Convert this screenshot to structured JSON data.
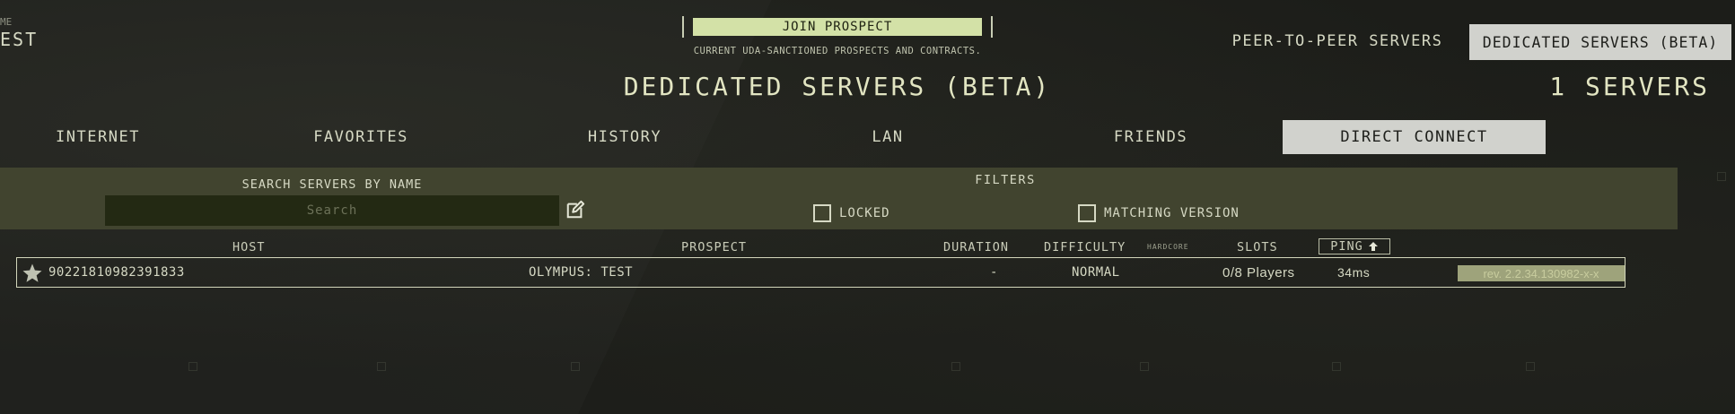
{
  "profile": {
    "label": "ME",
    "name": "EST"
  },
  "join": {
    "button_label": "JOIN PROSPECT",
    "subtitle": "CURRENT UDA-SANCTIONED PROSPECTS AND CONTRACTS."
  },
  "server_type_tabs": [
    {
      "label": "PEER-TO-PEER SERVERS",
      "active": false
    },
    {
      "label": "DEDICATED SERVERS (BETA)",
      "active": true
    }
  ],
  "title": "DEDICATED SERVERS (BETA)",
  "server_count": "1 SERVERS",
  "category_tabs": [
    {
      "label": "INTERNET",
      "active": false
    },
    {
      "label": "FAVORITES",
      "active": false
    },
    {
      "label": "HISTORY",
      "active": false
    },
    {
      "label": "LAN",
      "active": false
    },
    {
      "label": "FRIENDS",
      "active": false
    },
    {
      "label": "DIRECT CONNECT",
      "active": true
    }
  ],
  "search": {
    "label": "SEARCH SERVERS BY NAME",
    "placeholder": "Search",
    "value": ""
  },
  "filters": {
    "label": "FILTERS",
    "options": [
      {
        "label": "LOCKED",
        "checked": false
      },
      {
        "label": "MATCHING VERSION",
        "checked": false
      }
    ]
  },
  "columns": {
    "host": "HOST",
    "prospect": "PROSPECT",
    "duration": "DURATION",
    "difficulty": "DIFFICULTY",
    "hardcore": "HARDCORE",
    "slots": "SLOTS",
    "ping": "PING"
  },
  "servers": [
    {
      "host": "90221810982391833",
      "prospect": "OLYMPUS: TEST",
      "duration": "-",
      "difficulty": "NORMAL",
      "slots": "0/8 Players",
      "ping": "34ms",
      "version": "rev. 2.2.34.130982-x-x"
    }
  ],
  "colors": {
    "accent_green": "#d3e1a7",
    "panel": "#41442f",
    "active_tab": "#d1d2cd",
    "version_badge": "#9ea37b"
  },
  "icons": {
    "favorite": "star-icon",
    "edit": "edit-icon",
    "sort": "arrow-up-icon"
  }
}
